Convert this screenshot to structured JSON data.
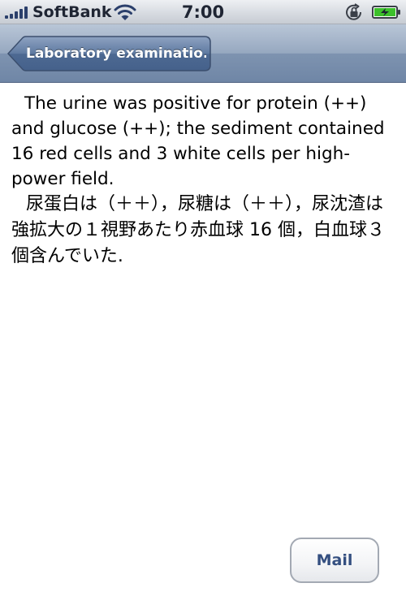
{
  "status_bar": {
    "carrier": "SoftBank",
    "time": "7:00",
    "signal_icon": "signal-bars-icon",
    "wifi_icon": "wifi-icon",
    "lock_icon": "orientation-lock-icon",
    "battery_icon": "battery-charging-icon"
  },
  "nav_bar": {
    "back_label": "Laboratory examinatio..."
  },
  "content": {
    "english": "The urine was positive for protein (++) and glucose (++); the sediment contained 16 red cells and 3 white cells per high-power field.",
    "japanese": "尿蛋白は（＋＋），尿糖は（＋＋），尿沈渣は強拡大の１視野あたり赤血球 16 個，白血球３個含んでいた."
  },
  "actions": {
    "mail_label": "Mail"
  },
  "colors": {
    "nav_tint": "#6f86a6",
    "mail_text": "#344f80",
    "battery_fill": "#3cc02b"
  }
}
